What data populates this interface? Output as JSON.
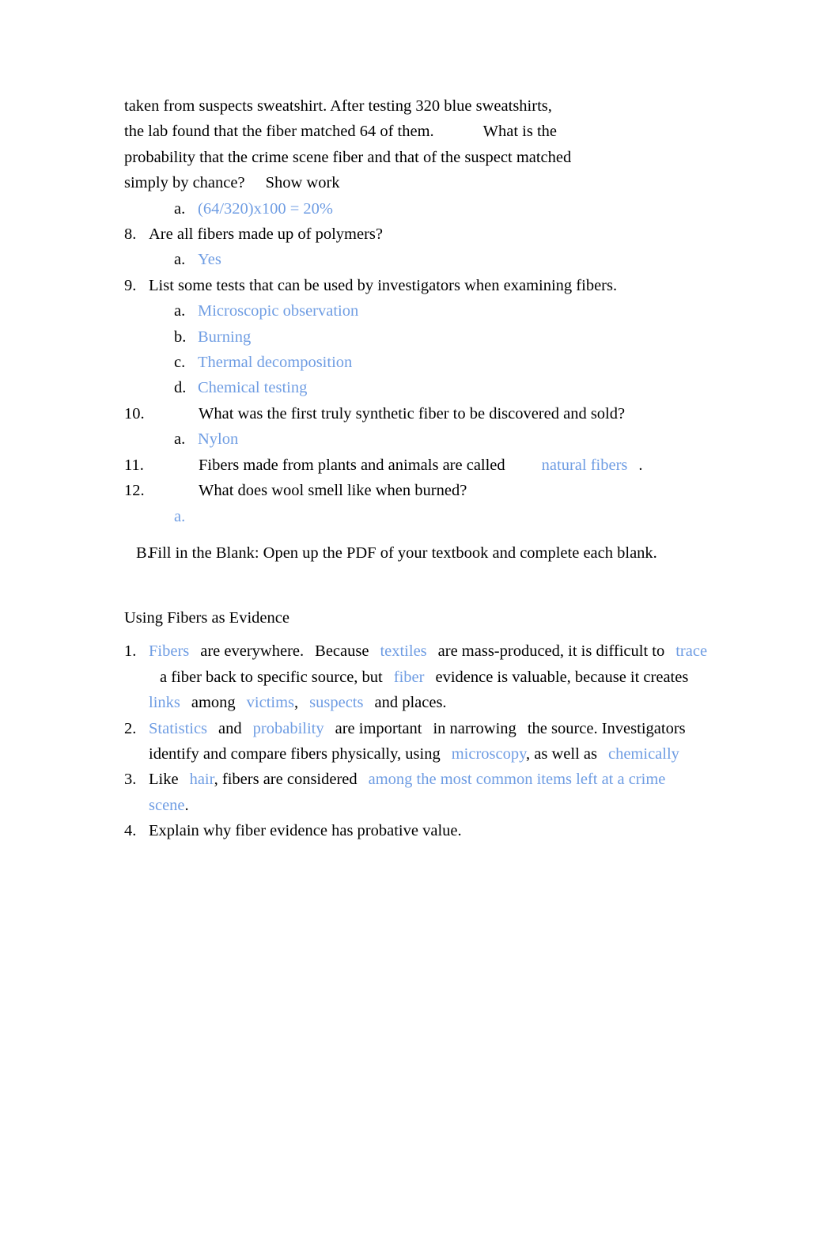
{
  "document": {
    "type": "worksheet",
    "title": "Fiber Evidence Worksheet",
    "answer_color": "#6f9de3",
    "text_color": "#000000",
    "background_color": "#ffffff"
  },
  "section_a_continued": {
    "q7_wrap": {
      "line1": "taken from suspects sweatshirt. After testing 320 blue sweatshirts,",
      "line2a": "the lab found that the fiber matched 64 of them.",
      "line2b": "What is the",
      "line3": "probability that the crime scene fiber and that of the suspect matched",
      "line4a": "simply by chance?",
      "line4b": "Show work",
      "answer_marker": "a.",
      "answer": "(64/320)x100 = 20%"
    },
    "items": [
      {
        "number": "8.",
        "wide": false,
        "question": "Are all fibers made up of polymers?",
        "answers": [
          {
            "marker": "a.",
            "text": "Yes"
          }
        ]
      },
      {
        "number": "9.",
        "wide": false,
        "question": "List some tests that can be used by investigators when examining fibers.",
        "answers": [
          {
            "marker": "a.",
            "text": "Microscopic observation"
          },
          {
            "marker": "b.",
            "text": "Burning"
          },
          {
            "marker": "c.",
            "text": "Thermal decomposition"
          },
          {
            "marker": "d.",
            "text": "Chemical testing"
          }
        ]
      },
      {
        "number": "10.",
        "wide": true,
        "question": "What was the first truly synthetic fiber to be discovered and sold?",
        "answers": [
          {
            "marker": "a.",
            "text": "Nylon"
          }
        ]
      },
      {
        "number": "11.",
        "wide": true,
        "question_pre": "Fibers made from plants and animals are called",
        "blank_answer": "natural fibers",
        "question_post": ".",
        "answers": []
      },
      {
        "number": "12.",
        "wide": true,
        "question": "What does wool smell like when burned?",
        "answers": [
          {
            "marker": "a.",
            "text": ""
          }
        ]
      }
    ]
  },
  "section_b": {
    "marker": "B.",
    "instruction": "Fill in the Blank: Open up the PDF of your textbook and complete each blank.",
    "heading": "Using Fibers as Evidence",
    "items": [
      {
        "number": "1.",
        "parts": [
          {
            "text": "Fibers",
            "blue": true
          },
          {
            "text": "are everywhere.",
            "blue": false
          },
          {
            "text": "Because",
            "blue": false
          },
          {
            "text": "textiles",
            "blue": true
          },
          {
            "text": "are mass-produced, it is difficult to",
            "blue": false
          },
          {
            "text": "trace",
            "blue": true
          },
          {
            "text": "a fiber back to specific source, but",
            "blue": false
          },
          {
            "text": "fiber",
            "blue": true
          },
          {
            "text": "evidence is valuable, because it creates",
            "blue": false
          },
          {
            "text": "links",
            "blue": true
          },
          {
            "text": "among",
            "blue": false
          },
          {
            "text": "victims",
            "blue": true
          },
          {
            "text": ",",
            "blue": false
          },
          {
            "text": "suspects",
            "blue": true
          },
          {
            "text": "and places.",
            "blue": false
          }
        ]
      },
      {
        "number": "2.",
        "parts": [
          {
            "text": "Statistics",
            "blue": true
          },
          {
            "text": "and",
            "blue": false
          },
          {
            "text": "probability",
            "blue": true
          },
          {
            "text": "are important",
            "blue": false
          },
          {
            "text": "in narrowing",
            "blue": false
          },
          {
            "text": "the source. Investigators identify and compare fibers physically, using",
            "blue": false
          },
          {
            "text": "microscopy",
            "blue": true
          },
          {
            "text": ", as well as",
            "blue": false
          },
          {
            "text": "chemically",
            "blue": true
          }
        ]
      },
      {
        "number": "3.",
        "parts": [
          {
            "text": "Like",
            "blue": false
          },
          {
            "text": "hair",
            "blue": true
          },
          {
            "text": ", fibers are considered",
            "blue": false
          },
          {
            "text": "among the most common items left at a crime scene",
            "blue": true
          },
          {
            "text": ".",
            "blue": false
          }
        ]
      },
      {
        "number": "4.",
        "parts": [
          {
            "text": "Explain why fiber evidence has probative value.",
            "blue": false
          }
        ]
      }
    ]
  }
}
